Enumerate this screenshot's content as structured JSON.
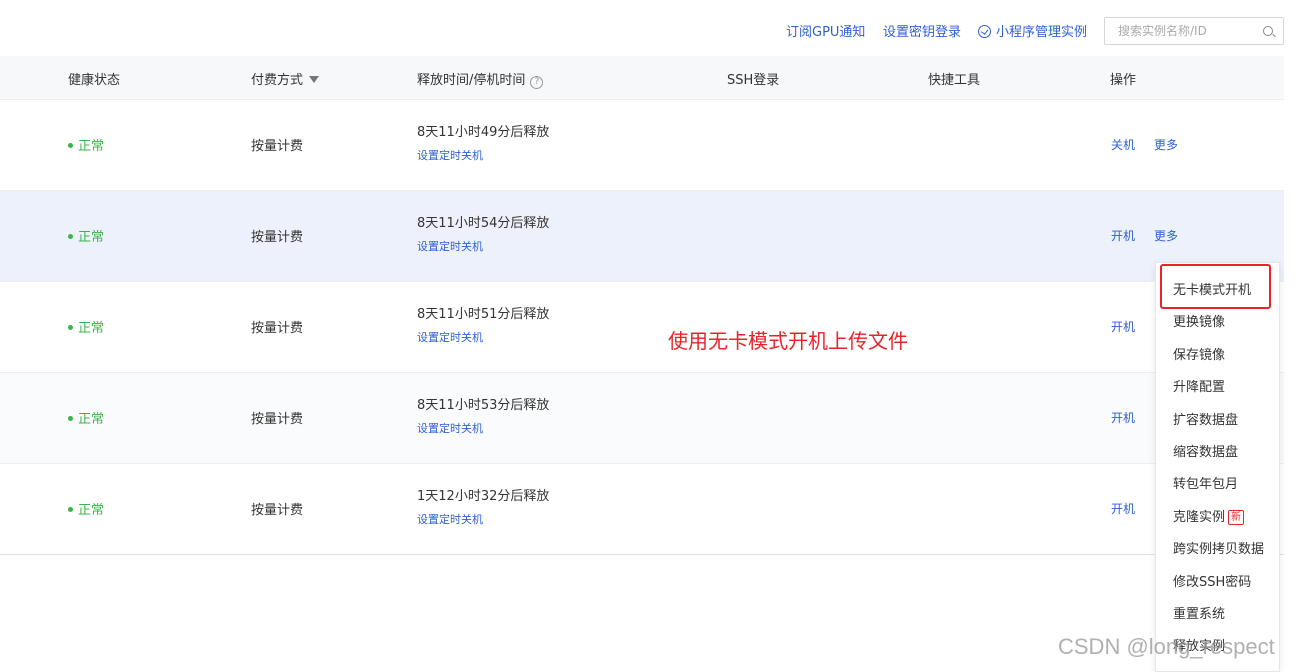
{
  "toolbar": {
    "gpu_notify": "订阅GPU通知",
    "key_login": "设置密钥登录",
    "miniprogram": "小程序管理实例",
    "search_placeholder": "搜索实例名称/ID"
  },
  "columns": {
    "health": "健康状态",
    "billing": "付费方式",
    "release_time": "释放时间/停机时间",
    "ssh": "SSH登录",
    "tools": "快捷工具",
    "actions": "操作"
  },
  "rows": [
    {
      "status": "正常",
      "billing": "按量计费",
      "release": "8天11小时49分后释放",
      "timer": "设置定时关机",
      "power": "关机",
      "more": "更多"
    },
    {
      "status": "正常",
      "billing": "按量计费",
      "release": "8天11小时54分后释放",
      "timer": "设置定时关机",
      "power": "开机",
      "more": "更多"
    },
    {
      "status": "正常",
      "billing": "按量计费",
      "release": "8天11小时51分后释放",
      "timer": "设置定时关机",
      "power": "开机"
    },
    {
      "status": "正常",
      "billing": "按量计费",
      "release": "8天11小时53分后释放",
      "timer": "设置定时关机",
      "power": "开机"
    },
    {
      "status": "正常",
      "billing": "按量计费",
      "release": "1天12小时32分后释放",
      "timer": "设置定时关机",
      "power": "开机"
    }
  ],
  "more_menu": {
    "items": [
      "无卡模式开机",
      "更换镜像",
      "保存镜像",
      "升降配置",
      "扩容数据盘",
      "缩容数据盘",
      "转包年包月",
      "克隆实例",
      "跨实例拷贝数据",
      "修改SSH密码",
      "重置系统",
      "释放实例"
    ],
    "new_badge": "新"
  },
  "annotation": "使用无卡模式开机上传文件",
  "watermark": "CSDN @long_respect",
  "colors": {
    "link": "#2f5fd4",
    "status_ok": "#3cb34a",
    "highlight_red": "#e8232a",
    "row_hover": "#edf1fb"
  },
  "icons": {
    "miniprogram": "check-circle-icon",
    "search": "search-icon",
    "filter": "filter-icon",
    "help": "question-circle-icon"
  }
}
